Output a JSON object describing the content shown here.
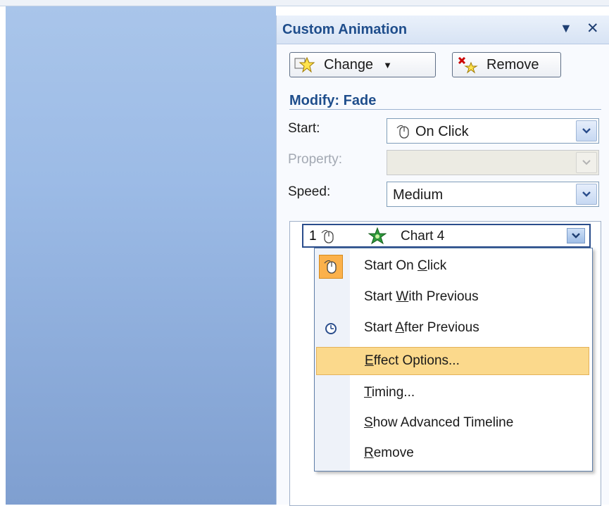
{
  "pane": {
    "title": "Custom Animation"
  },
  "toolbar": {
    "change_label": "Change",
    "remove_label": "Remove"
  },
  "modify": {
    "title": "Modify: Fade",
    "start_label": "Start:",
    "start_value": "On Click",
    "property_label": "Property:",
    "property_value": "",
    "speed_label": "Speed:",
    "speed_value": "Medium"
  },
  "list": {
    "items": [
      {
        "number": "1",
        "label": "Chart 4"
      }
    ]
  },
  "context_menu": {
    "items": [
      {
        "pre": "Start On ",
        "key": "C",
        "post": "lick"
      },
      {
        "pre": "Start ",
        "key": "W",
        "post": "ith Previous"
      },
      {
        "pre": "Start ",
        "key": "A",
        "post": "fter Previous"
      },
      {
        "pre": "",
        "key": "E",
        "post": "ffect Options..."
      },
      {
        "pre": "",
        "key": "T",
        "post": "iming..."
      },
      {
        "pre": "",
        "key": "S",
        "post": "how Advanced Timeline"
      },
      {
        "pre": "",
        "key": "R",
        "post": "emove"
      }
    ]
  },
  "colors": {
    "accent": "#1f4e8c",
    "highlight": "#fbd98c",
    "slide_bg": "#9cbbe6"
  }
}
